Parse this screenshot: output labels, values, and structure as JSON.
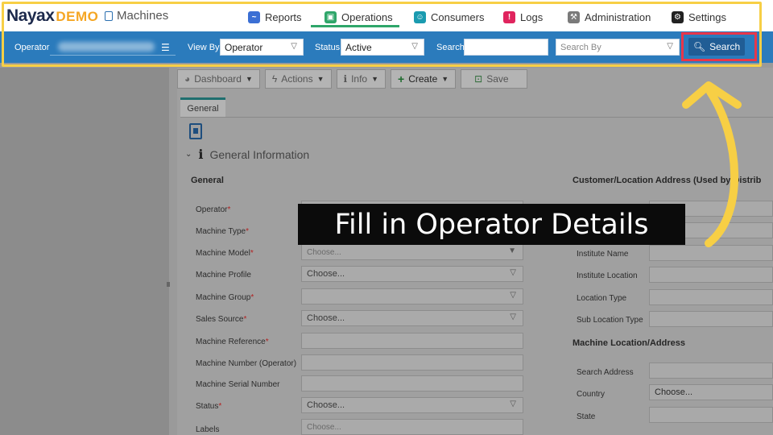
{
  "brand": {
    "logo": "Nayax",
    "logo_suffix": "DEMO",
    "module": "Machines"
  },
  "nav": {
    "items": [
      {
        "label": "Reports",
        "icon": "chart-icon",
        "color": "#3b6fd4"
      },
      {
        "label": "Operations",
        "icon": "operations-icon",
        "color": "#2fa66a"
      },
      {
        "label": "Consumers",
        "icon": "consumers-icon",
        "color": "#1b9bb0"
      },
      {
        "label": "Logs",
        "icon": "logs-icon",
        "color": "#e0245e"
      },
      {
        "label": "Administration",
        "icon": "administration-icon",
        "color": "#7a7a7a"
      },
      {
        "label": "Settings",
        "icon": "settings-icon",
        "color": "#222222"
      }
    ],
    "active": "Operations"
  },
  "filter": {
    "operator_label": "Operator",
    "view_by_label": "View By",
    "view_by_value": "Operator",
    "status_label": "Status",
    "status_value": "Active",
    "search_label": "Search",
    "search_value": "",
    "search_by_placeholder": "Search By",
    "search_button": "Search"
  },
  "toolbar": {
    "dashboard": "Dashboard",
    "actions": "Actions",
    "info": "Info",
    "create": "Create",
    "save": "Save"
  },
  "tabs": {
    "general": "General"
  },
  "section": {
    "title": "General Information"
  },
  "left_column": {
    "heading": "General",
    "fields": [
      {
        "label": "Operator",
        "required": true,
        "value": "",
        "type": "text"
      },
      {
        "label": "Machine Type",
        "required": true,
        "value": "",
        "type": "text"
      },
      {
        "label": "Machine Model",
        "required": true,
        "value": "Choose...",
        "type": "select"
      },
      {
        "label": "Machine Profile",
        "required": false,
        "value": "Choose...",
        "type": "select"
      },
      {
        "label": "Machine Group",
        "required": true,
        "value": "",
        "type": "select"
      },
      {
        "label": "Sales Source",
        "required": true,
        "value": "Choose...",
        "type": "select"
      },
      {
        "label": "Machine Reference",
        "required": true,
        "value": "",
        "type": "text"
      },
      {
        "label": "Machine Number (Operator)",
        "required": false,
        "value": "",
        "type": "text"
      },
      {
        "label": "Machine Serial Number",
        "required": false,
        "value": "",
        "type": "text"
      },
      {
        "label": "Status",
        "required": true,
        "value": "Choose...",
        "type": "select"
      },
      {
        "label": "Labels",
        "required": false,
        "value": "Choose...",
        "type": "text"
      }
    ]
  },
  "right_column": {
    "heading": "Customer/Location Address (Used by Distrib",
    "fields": [
      {
        "label": "Institute Name",
        "value": ""
      },
      {
        "label": "Institute Location",
        "value": ""
      },
      {
        "label": "Location Type",
        "value": ""
      },
      {
        "label": "Sub Location Type",
        "value": ""
      }
    ],
    "heading2": "Machine Location/Address",
    "fields2": [
      {
        "label": "Search Address",
        "value": ""
      },
      {
        "label": "Country",
        "value": "Choose..."
      },
      {
        "label": "State",
        "value": ""
      }
    ]
  },
  "overlay": {
    "caption": "Fill in Operator Details"
  }
}
